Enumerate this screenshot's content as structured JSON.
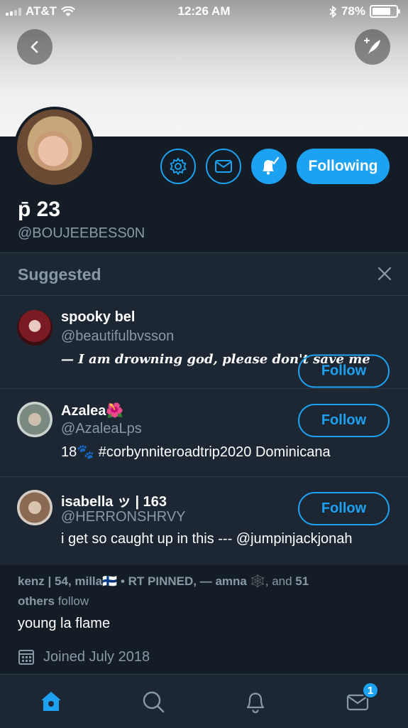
{
  "status_bar": {
    "carrier": "AT&T",
    "time": "12:26 AM",
    "battery": "78%"
  },
  "profile": {
    "display_name": "p̄ 23",
    "handle": "@BOUJEEBESS0N",
    "following_label": "Following",
    "bio": "young la flame",
    "joined": "Joined July 2018",
    "followers_you_know": {
      "names": "kenz | 54, milla🇫🇮 • RT PINNED, — amna 🕸️",
      "and_text": ", and",
      "count": "51",
      "others": "others",
      "follow": "follow"
    }
  },
  "suggested": {
    "title": "Suggested",
    "follow_label": "Follow",
    "users": [
      {
        "name": "spooky bel",
        "handle": "@beautifulbvsson",
        "bio": "— I am drowning god, please don't save me"
      },
      {
        "name": "Azalea🌺",
        "handle": "@AzaleaLps",
        "bio": "18🐾 #corbynniteroadtrip2020 Dominicana"
      },
      {
        "name": "isabella ッ | 163",
        "handle": "@HERRONSHRVY",
        "bio": "i get so caught up in this --- @jumpinjackjonah"
      }
    ]
  },
  "tabbar": {
    "messages_badge": "1"
  },
  "colors": {
    "accent": "#1da1f2",
    "background": "#141d26",
    "panel": "#1c2733",
    "muted_text": "#8899a6"
  },
  "icons": [
    "back-arrow-icon",
    "compose-tweet-icon",
    "gear-icon",
    "envelope-icon",
    "bell-check-icon",
    "close-icon",
    "calendar-icon",
    "home-icon",
    "search-icon",
    "notifications-icon",
    "messages-icon"
  ]
}
